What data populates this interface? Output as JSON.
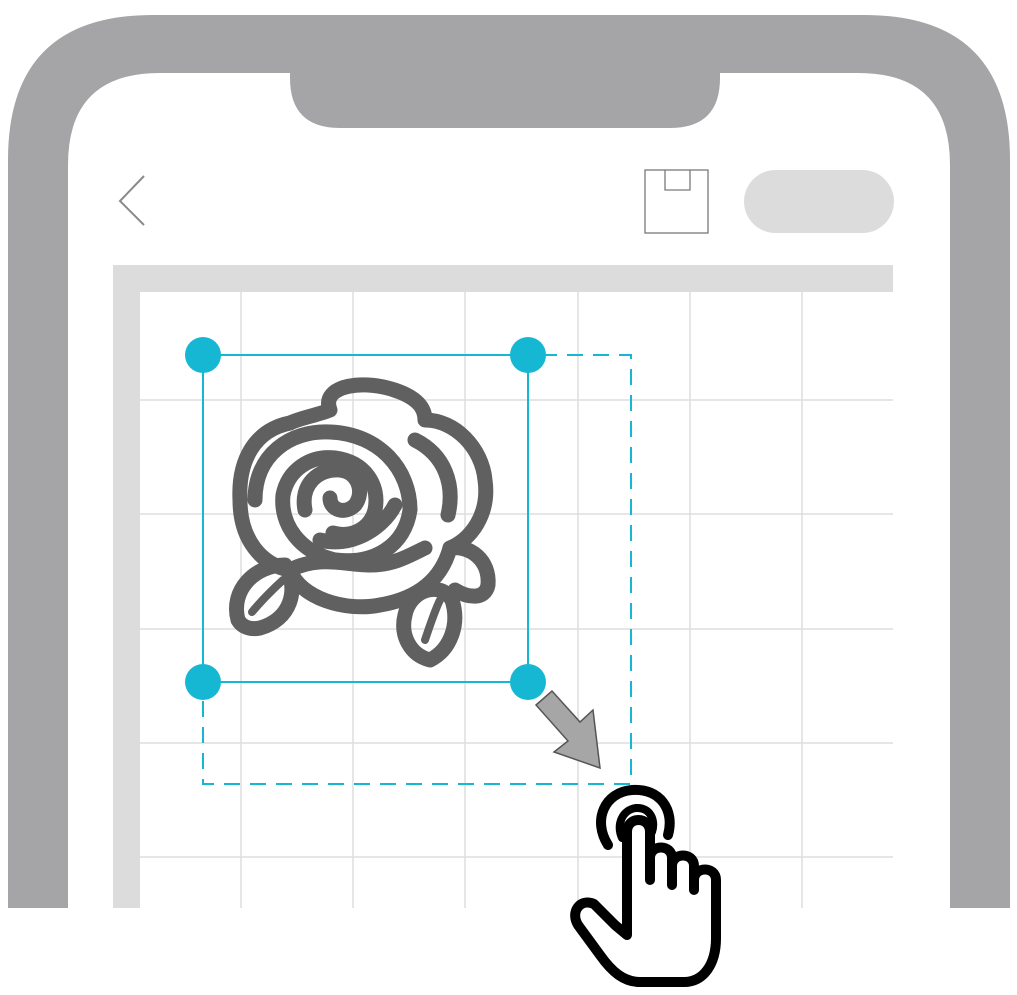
{
  "app": {
    "title": ""
  },
  "header": {
    "back_icon": "chevron-left-icon",
    "save_icon": "save-icon",
    "action_button_label": ""
  },
  "canvas": {
    "grid": true,
    "design_icon": "rose-icon",
    "selection": {
      "handles": [
        "top-left",
        "top-right",
        "bottom-left",
        "bottom-right"
      ],
      "resize_direction": "down-right"
    },
    "gesture_icon": "hand-pointer-icon"
  },
  "colors": {
    "phone_frame": "#a5a5a7",
    "canvas_bg": "#dcdcdc",
    "grid_line": "#dedede",
    "selection": "#16b7d3",
    "design": "#606060",
    "arrow": "#a6a6a6",
    "button": "#dcdcdc"
  }
}
